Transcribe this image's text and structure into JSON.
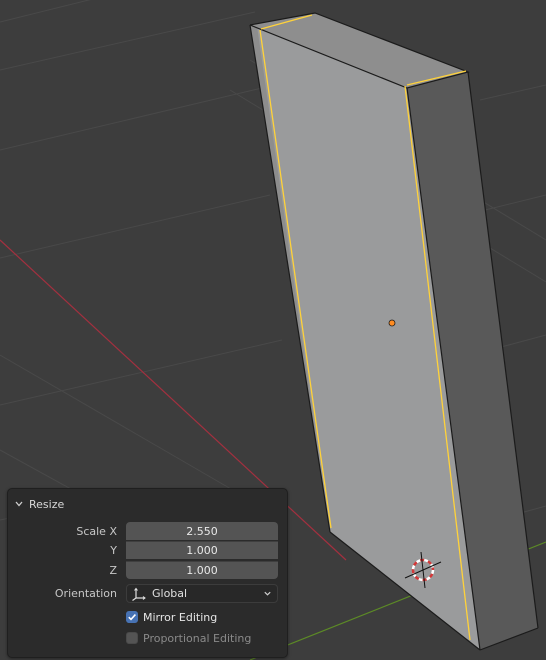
{
  "panel": {
    "title": "Resize",
    "scale": {
      "x_label": "Scale X",
      "y_label": "Y",
      "z_label": "Z",
      "x_value": "2.550",
      "y_value": "1.000",
      "z_value": "1.000"
    },
    "orientation": {
      "label": "Orientation",
      "value": "Global",
      "icon": "orientation-axes-icon"
    },
    "mirror_editing": {
      "label": "Mirror Editing",
      "checked": true
    },
    "proportional_editing": {
      "label": "Proportional Editing",
      "checked": false
    }
  },
  "viewport": {
    "background_color": "#3d3d3d",
    "x_axis_color": "#a3303f",
    "y_axis_color": "#5c8a26",
    "selection_color": "#ffd23a",
    "origin_color": "#ff8c21"
  }
}
